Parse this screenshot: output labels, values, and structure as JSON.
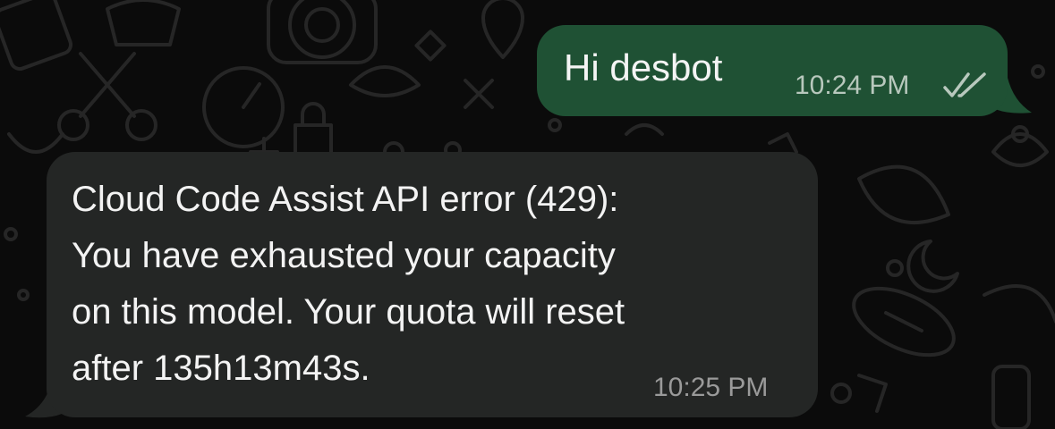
{
  "chat": {
    "messages": [
      {
        "direction": "outgoing",
        "text": "Hi desbot",
        "time": "10:24 PM",
        "status_icon": "double-check-icon"
      },
      {
        "direction": "incoming",
        "lines": [
          "Cloud Code Assist API error (429):",
          "You have exhausted your capacity",
          "on this model. Your quota will reset",
          "after 135h13m43s."
        ],
        "time": "10:25 PM"
      }
    ]
  },
  "colors": {
    "background": "#0b0b0b",
    "outgoing_bubble": "#1f5134",
    "incoming_bubble": "#242625",
    "text": "#f3f3f3",
    "outgoing_time": "#b8c8bd",
    "incoming_time": "#9a9a9a",
    "doodle": "#2a2a2a"
  }
}
